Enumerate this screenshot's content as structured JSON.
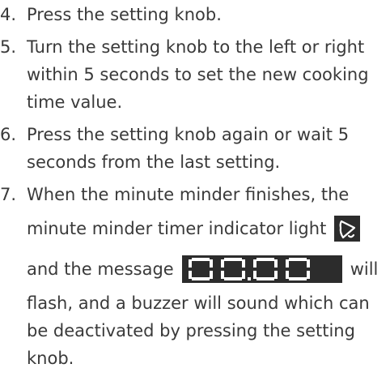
{
  "steps": [
    {
      "number": "4.",
      "lines": [
        "Press the setting knob."
      ]
    },
    {
      "number": "5.",
      "lines": [
        "Turn the setting knob to the left or right",
        "within 5 seconds to set the new cooking",
        "time value."
      ]
    },
    {
      "number": "6.",
      "lines": [
        "Press the setting knob again or wait 5",
        "seconds from the last setting."
      ]
    },
    {
      "number": "7.",
      "line1": "When the minute minder finishes, the",
      "line2": "minute minder timer indicator light",
      "line3_before": "and the message",
      "line3_after": "will",
      "lines_rest": [
        "flash, and a buzzer will sound which can",
        "be deactivated by pressing the setting",
        "knob."
      ]
    }
  ],
  "icons": {
    "bell": "minute-minder-bell-icon",
    "display": "segment-display-00-00"
  },
  "display_text": "00.00",
  "colors": {
    "text": "#3a3a3a",
    "icon_background": "#2c2c2c",
    "icon_foreground": "#ffffff"
  }
}
